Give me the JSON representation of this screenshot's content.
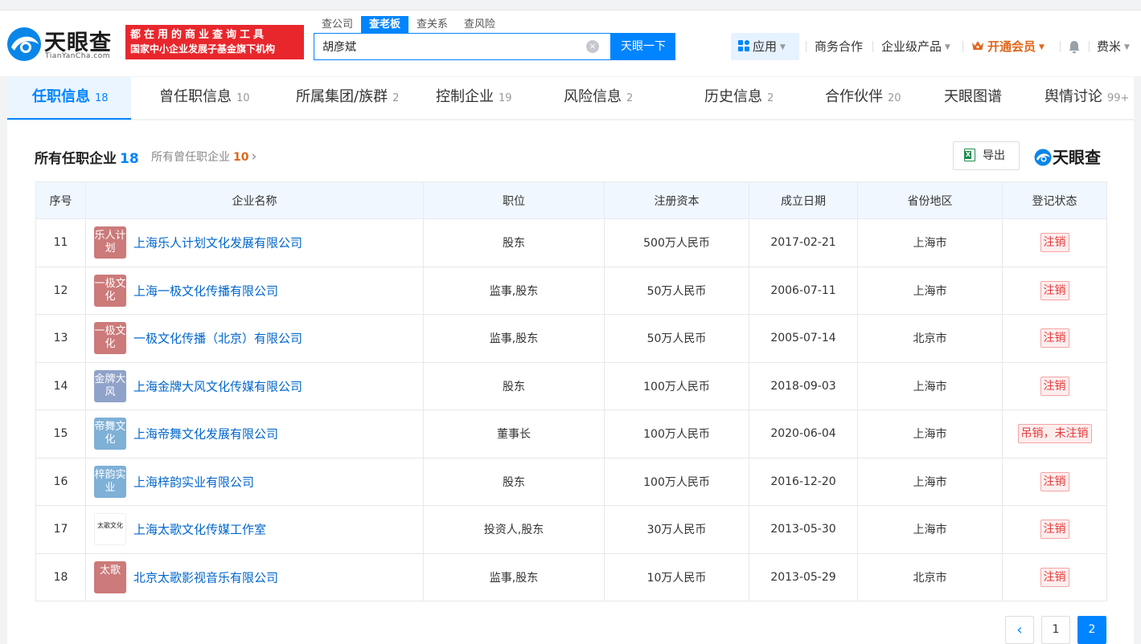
{
  "header": {
    "logo": {
      "name": "天眼查",
      "domain": "TianYanCha.com"
    },
    "slogan": {
      "line1": "都在用的商业查询工具",
      "line2": "国家中小企业发展子基金旗下机构"
    },
    "search_tabs": [
      {
        "label": "查公司",
        "active": false
      },
      {
        "label": "查老板",
        "active": true
      },
      {
        "label": "查关系",
        "active": false
      },
      {
        "label": "查风险",
        "active": false
      }
    ],
    "search_value": "胡彦斌",
    "clear_glyph": "×",
    "search_button": "天眼一下",
    "apps_label": "应用",
    "business": "商务合作",
    "enterprise": "企业级产品",
    "vip": "开通会员",
    "user": "费米",
    "caret": "▼"
  },
  "tabs": [
    {
      "label": "任职信息",
      "count": "18",
      "active": true
    },
    {
      "label": "曾任职信息",
      "count": "10",
      "active": false
    },
    {
      "label": "所属集团/族群",
      "count": "2",
      "active": false
    },
    {
      "label": "控制企业",
      "count": "19",
      "active": false
    },
    {
      "label": "风险信息",
      "count": "2",
      "active": false
    },
    {
      "label": "历史信息",
      "count": "2",
      "active": false
    },
    {
      "label": "合作伙伴",
      "count": "20",
      "active": false
    },
    {
      "label": "天眼图谱",
      "count": "",
      "active": false
    },
    {
      "label": "舆情讨论",
      "count": "99+",
      "active": false
    }
  ],
  "section": {
    "title": "所有任职企业",
    "count": "18",
    "sub_label": "所有曾任职企业",
    "sub_count": "10",
    "sub_arrow": "›",
    "export": "导出",
    "brand": "天眼查"
  },
  "table": {
    "headers": [
      "序号",
      "企业名称",
      "职位",
      "注册资本",
      "成立日期",
      "省份地区",
      "登记状态"
    ],
    "rows": [
      {
        "no": "11",
        "logo": "乐人计划",
        "logo_color": "#cc7a7a",
        "name": "上海乐人计划文化发展有限公司",
        "position": "股东",
        "capital": "500万人民币",
        "date": "2017-02-21",
        "region": "上海市",
        "status": "注销"
      },
      {
        "no": "12",
        "logo": "一极文化",
        "logo_color": "#cc7a7a",
        "name": "上海一极文化传播有限公司",
        "position": "监事,股东",
        "capital": "50万人民币",
        "date": "2006-07-11",
        "region": "上海市",
        "status": "注销"
      },
      {
        "no": "13",
        "logo": "一极文化",
        "logo_color": "#cc7a7a",
        "name": "一极文化传播（北京）有限公司",
        "position": "监事,股东",
        "capital": "50万人民币",
        "date": "2005-07-14",
        "region": "北京市",
        "status": "注销"
      },
      {
        "no": "14",
        "logo": "金牌大风",
        "logo_color": "#8fa2c9",
        "name": "上海金牌大风文化传媒有限公司",
        "position": "股东",
        "capital": "100万人民币",
        "date": "2018-09-03",
        "region": "上海市",
        "status": "注销"
      },
      {
        "no": "15",
        "logo": "帝舞文化",
        "logo_color": "#7fb0d6",
        "name": "上海帝舞文化发展有限公司",
        "position": "董事长",
        "capital": "100万人民币",
        "date": "2020-06-04",
        "region": "上海市",
        "status": "吊销，未注销"
      },
      {
        "no": "16",
        "logo": "梓韵实业",
        "logo_color": "#7fb0d6",
        "name": "上海梓韵实业有限公司",
        "position": "股东",
        "capital": "100万人民币",
        "date": "2016-12-20",
        "region": "上海市",
        "status": "注销"
      },
      {
        "no": "17",
        "logo": "太歌文化",
        "logo_color": "image",
        "name": "上海太歌文化传媒工作室",
        "position": "投资人,股东",
        "capital": "30万人民币",
        "date": "2013-05-30",
        "region": "上海市",
        "status": "注销"
      },
      {
        "no": "18",
        "logo": "太歌",
        "logo_color": "#cc7a7a",
        "name": "北京太歌影视音乐有限公司",
        "position": "监事,股东",
        "capital": "10万人民币",
        "date": "2013-05-29",
        "region": "北京市",
        "status": "注销"
      }
    ]
  },
  "pagination": {
    "prev": "‹",
    "pages": [
      "1",
      "2"
    ],
    "current": "2"
  },
  "colors": {
    "accent": "#0084ff",
    "slogan_bg": "#e8272d",
    "status_red": "#e63939",
    "vip_orange": "#e0661b"
  }
}
